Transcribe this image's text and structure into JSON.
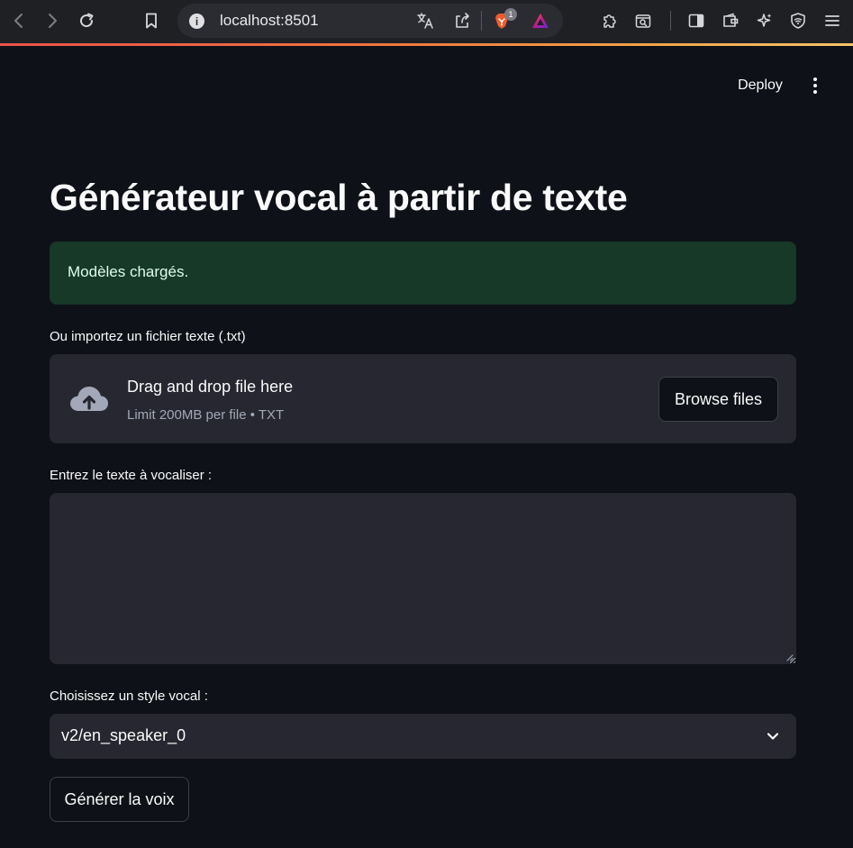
{
  "browser": {
    "url": "localhost:8501",
    "brave_badge_count": "1",
    "icons": [
      "back-icon",
      "forward-icon",
      "reload-icon",
      "bookmark-icon",
      "info-icon",
      "translate-icon",
      "share-icon",
      "brave-shields-icon",
      "brave-rewards-icon",
      "extensions-icon",
      "search-tabs-icon",
      "sidebar-icon",
      "wallet-icon",
      "leo-ai-icon",
      "vpn-icon",
      "menu-icon"
    ]
  },
  "header": {
    "deploy_label": "Deploy"
  },
  "main": {
    "title": "Générateur vocal à partir de texte",
    "success_message": "Modèles chargés.",
    "uploader": {
      "label": "Ou importez un fichier texte (.txt)",
      "drop_text": "Drag and drop file here",
      "limit_text": "Limit 200MB per file • TXT",
      "browse_label": "Browse files"
    },
    "text_input": {
      "label": "Entrez le texte à vocaliser :",
      "value": ""
    },
    "voice_select": {
      "label": "Choisissez un style vocal :",
      "selected": "v2/en_speaker_0"
    },
    "generate_label": "Générer la voix"
  },
  "colors": {
    "background": "#0e1117",
    "widget_bg": "#262730",
    "success_bg": "#173928",
    "success_text": "#dffde9",
    "muted_text": "#a3a8b8"
  }
}
